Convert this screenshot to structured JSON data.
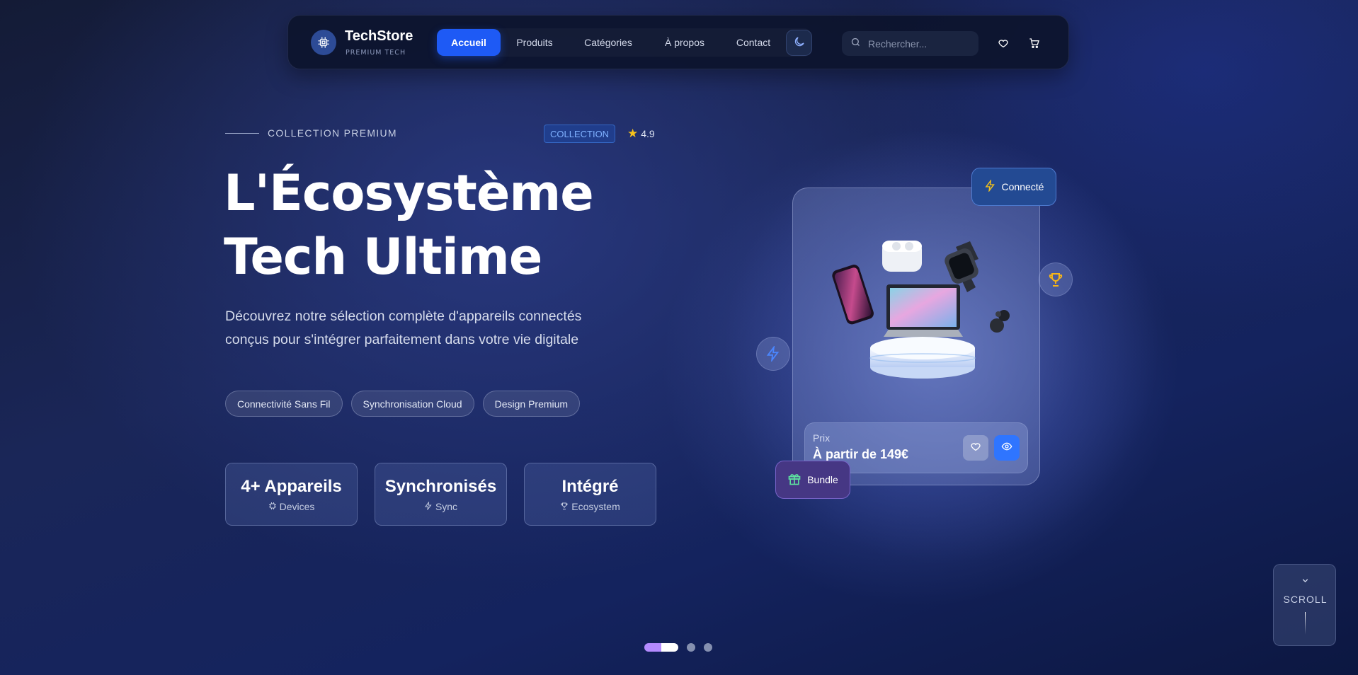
{
  "nav": {
    "brand_name": "TechStore",
    "brand_tagline": "PREMIUM TECH",
    "menu": [
      {
        "label": "Accueil",
        "active": true
      },
      {
        "label": "Produits",
        "active": false
      },
      {
        "label": "Catégories",
        "active": false
      },
      {
        "label": "À propos",
        "active": false
      },
      {
        "label": "Contact",
        "active": false
      }
    ],
    "search_placeholder": "Rechercher..."
  },
  "hero": {
    "eyebrow": "COLLECTION PREMIUM",
    "badge": "COLLECTION",
    "rating": "4.9",
    "title": "L'Écosystème Tech Ultime",
    "description": "Découvrez notre sélection complète d'appareils connectés conçus pour s'intégrer parfaitement dans votre vie digitale",
    "chips": [
      "Connectivité Sans Fil",
      "Synchronisation Cloud",
      "Design Premium"
    ],
    "stats": [
      {
        "value": "4+ Appareils",
        "label": "Devices",
        "icon": "chip-icon"
      },
      {
        "value": "Synchronisés",
        "label": "Sync",
        "icon": "bolt-icon"
      },
      {
        "value": "Intégré",
        "label": "Ecosystem",
        "icon": "trophy-icon"
      }
    ]
  },
  "product": {
    "price_label": "Prix",
    "price_value": "À partir de 149€",
    "badge_connected": "Connecté",
    "badge_bundle": "Bundle"
  },
  "scroll": {
    "label": "SCROLL"
  },
  "carousel": {
    "total": 3,
    "active_index": 0
  },
  "colors": {
    "accent": "#1e5af5",
    "view_button": "#2f75ff",
    "star": "#f7c21b",
    "bundle_icon": "#5de0a0",
    "trophy": "#f4b41a"
  }
}
